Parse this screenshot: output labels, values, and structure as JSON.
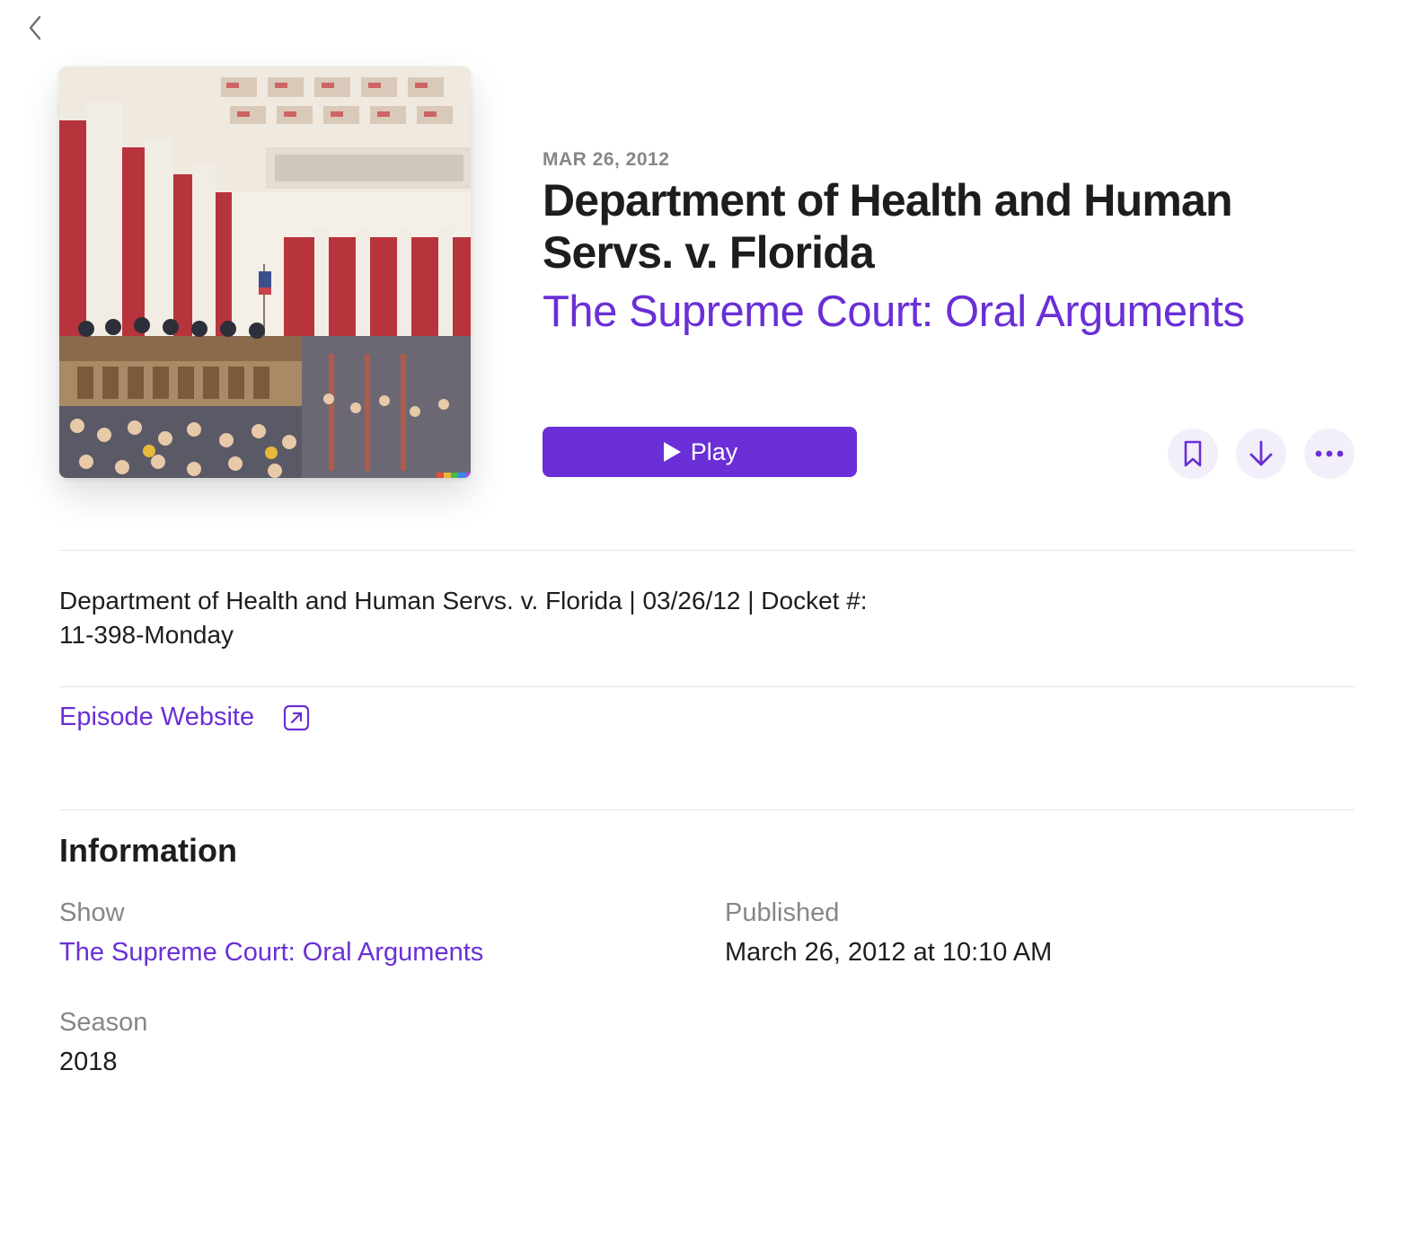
{
  "header": {
    "back_label": "Back"
  },
  "episode": {
    "date": "MAR 26, 2012",
    "title": "Department of Health and Human Servs. v. Florida",
    "show": "The Supreme Court: Oral Arguments",
    "play_label": "Play",
    "description_line1": "Department of Health and Human Servs. v. Florida | 03/26/12 | Docket #:",
    "description_line2": "11-398-Monday",
    "website_label": "Episode Website"
  },
  "actions": {
    "icons": [
      "bookmark-icon",
      "download-icon",
      "more-icon"
    ]
  },
  "information": {
    "heading": "Information",
    "show_label": "Show",
    "show_value": "The Supreme Court: Oral Arguments",
    "published_label": "Published",
    "published_value": "March 26, 2012 at 10:10 AM",
    "season_label": "Season",
    "season_value": "2018"
  },
  "colors": {
    "accent": "#6a2fd6",
    "secondary_text": "#86868b",
    "primary_text": "#1d1d1f",
    "button_tint": "#f3effa"
  }
}
